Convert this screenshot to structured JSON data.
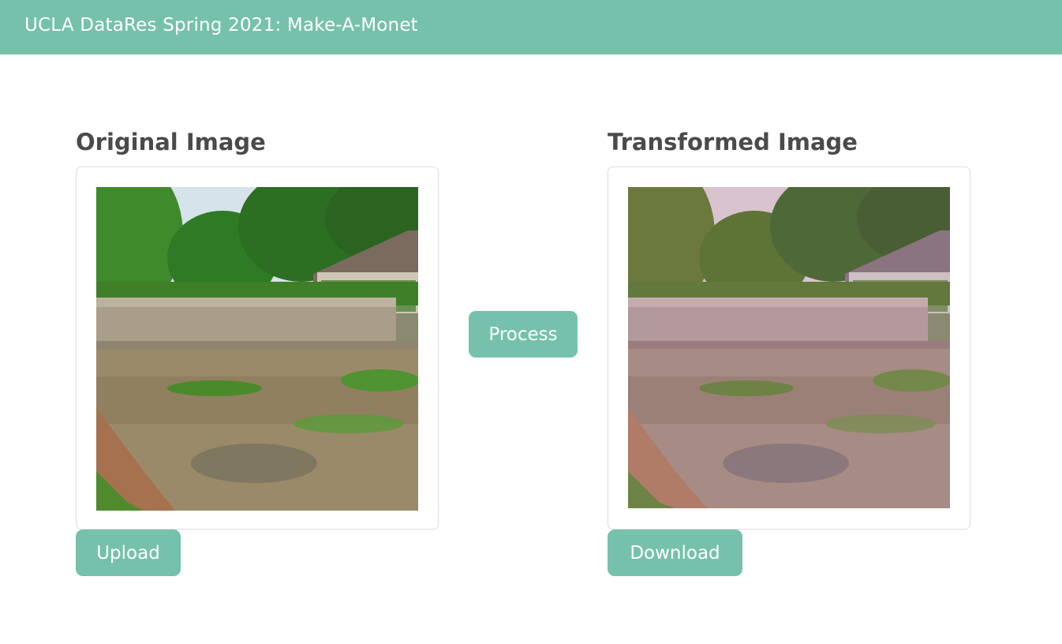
{
  "navbar": {
    "title": "UCLA DataRes Spring 2021: Make-A-Monet"
  },
  "original": {
    "heading": "Original Image",
    "upload_label": "Upload"
  },
  "process": {
    "label": "Process"
  },
  "transformed": {
    "heading": "Transformed Image",
    "download_label": "Download"
  },
  "colors": {
    "accent": "#76c1ab",
    "heading_text": "#4a4a4a",
    "button_text": "#ffffff"
  }
}
